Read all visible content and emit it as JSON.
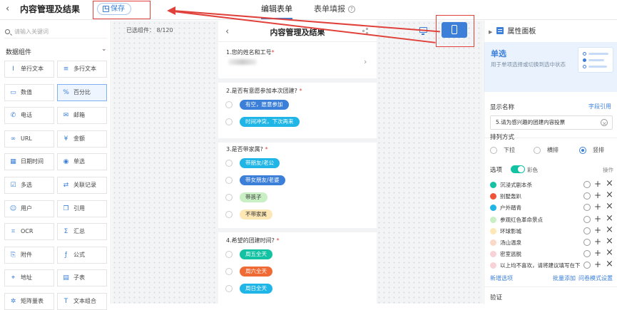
{
  "topbar": {
    "back_icon": "‹",
    "title": "内容管理及结果",
    "save_label": "保存",
    "tabs": [
      {
        "label": "编辑表单"
      },
      {
        "label": "表单填报"
      }
    ],
    "help_icon": "?"
  },
  "left_panel": {
    "search_placeholder": "请输入关键词",
    "section_label": "数据组件",
    "components": [
      {
        "label": "单行文本",
        "icon": "Ⅰ"
      },
      {
        "label": "多行文本",
        "icon": "≡"
      },
      {
        "label": "数值",
        "icon": "▭"
      },
      {
        "label": "百分比",
        "icon": "%"
      },
      {
        "label": "电话",
        "icon": "✆"
      },
      {
        "label": "邮箱",
        "icon": "✉"
      },
      {
        "label": "URL",
        "icon": "∞"
      },
      {
        "label": "金额",
        "icon": "¥"
      },
      {
        "label": "日期时间",
        "icon": "▦"
      },
      {
        "label": "单选",
        "icon": "◉"
      },
      {
        "label": "多选",
        "icon": "☑"
      },
      {
        "label": "关联记录",
        "icon": "⇄"
      },
      {
        "label": "用户",
        "icon": "☺"
      },
      {
        "label": "引用",
        "icon": "❐"
      },
      {
        "label": "OCR",
        "icon": "⌗"
      },
      {
        "label": "汇总",
        "icon": "Σ"
      },
      {
        "label": "附件",
        "icon": "⎘"
      },
      {
        "label": "公式",
        "icon": "ƒ"
      },
      {
        "label": "地址",
        "icon": "⌖"
      },
      {
        "label": "子表",
        "icon": "▤"
      },
      {
        "label": "矩阵量表",
        "icon": "✲"
      },
      {
        "label": "文本组合",
        "icon": "T"
      }
    ]
  },
  "canvas": {
    "selected_count": "已选组件：  8/120",
    "phone": {
      "title": "内容管理及结果",
      "questions": [
        {
          "title": "1.您的姓名和工号",
          "required": "*"
        },
        {
          "title": "2.是否有意愿参加本次团建?",
          "required": "*",
          "options": [
            {
              "label": "有空，愿意参加",
              "color": "#3b7fd8",
              "text_color": "#ffffff"
            },
            {
              "label": "时间冲突，下次再来",
              "color": "#1fb5e6",
              "text_color": "#ffffff"
            }
          ]
        },
        {
          "title": "3.是否带家属?",
          "required": "*",
          "options": [
            {
              "label": "带朋友/老公",
              "color": "#1fb5e6",
              "text_color": "#ffffff"
            },
            {
              "label": "带女朋友/老婆",
              "color": "#3b7fd8",
              "text_color": "#ffffff"
            },
            {
              "label": "带孩子",
              "color": "#c9efc4",
              "text_color": "#333333"
            },
            {
              "label": "不带家属",
              "color": "#fde7b4",
              "text_color": "#333333"
            }
          ]
        },
        {
          "title": "4.希望的团建时间?",
          "required": "*",
          "options": [
            {
              "label": "周五全天",
              "color": "#13c2a3",
              "text_color": "#ffffff"
            },
            {
              "label": "周六全天",
              "color": "#f06a35",
              "text_color": "#ffffff"
            },
            {
              "label": "周日全天",
              "color": "#1fb5e6",
              "text_color": "#ffffff"
            }
          ]
        }
      ]
    }
  },
  "right_panel": {
    "header": "属性面板",
    "banner_title": "单选",
    "banner_desc": "用于单项选择或切换到选中状态",
    "display_name_label": "显示名称",
    "field_ref_link": "字段引用",
    "display_name_value": "5.请为感兴趣的团建内容投票",
    "layout_label": "排列方式",
    "layout_options": [
      "下拉",
      "横排",
      "竖排"
    ],
    "layout_selected": "竖排",
    "options_label": "选项",
    "color_label": "彩色",
    "actions_label": "操作",
    "options": [
      {
        "label": "沉浸式剧本杀",
        "color": "#13c2a3"
      },
      {
        "label": "别墅轰趴",
        "color": "#f0523a"
      },
      {
        "label": "户外踏青",
        "color": "#1fb5e6"
      },
      {
        "label": "参观红色革命景点",
        "color": "#c9efc4"
      },
      {
        "label": "环球影城",
        "color": "#fde7b4"
      },
      {
        "label": "汤山温泉",
        "color": "#fbd9c9"
      },
      {
        "label": "密室逃脱",
        "color": "#f9d2d6"
      },
      {
        "label": "以上均不喜欢，请将建议填写在下方",
        "color": "#f9d2d6"
      }
    ],
    "add_option_link": "新增选项",
    "batch_add_link": "批量添加",
    "survey_mode_link": "问卷模式设置",
    "validation_label": "验证"
  }
}
